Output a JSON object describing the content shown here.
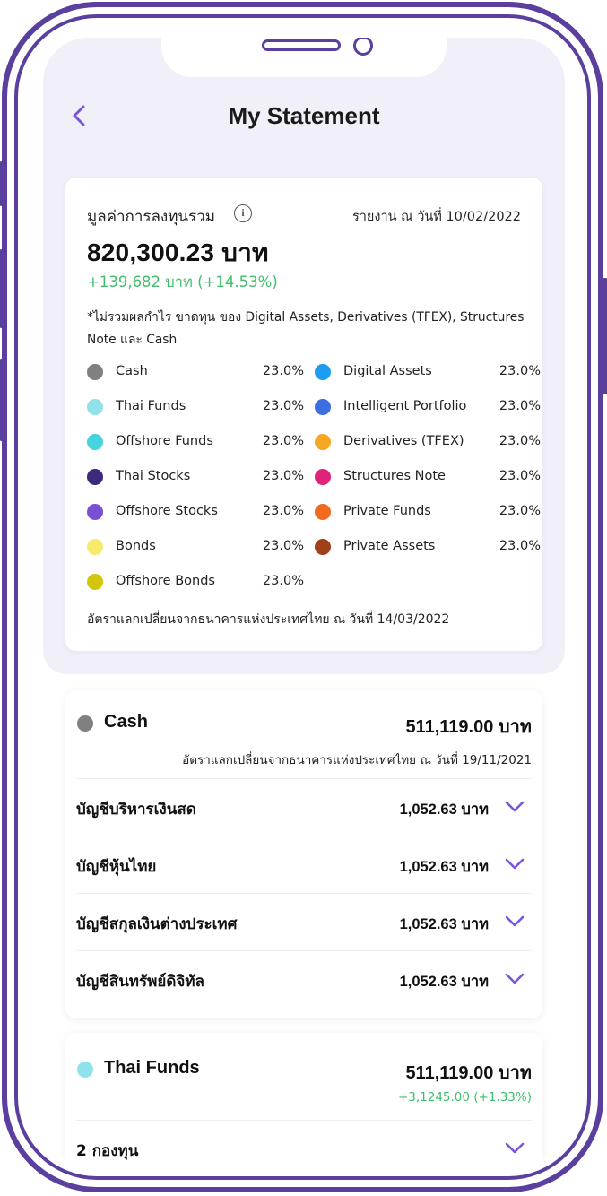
{
  "header": {
    "title": "My Statement"
  },
  "summary": {
    "label": "มูลค่าการลงทุนรวม",
    "report_date": "รายงาน ณ วันที่ 10/02/2022",
    "total": "820,300.23 บาท",
    "gain": "+139,682 บาท (+14.53%)",
    "note": "*ไม่รวมผลกำไร ขาดทุน ของ Digital Assets, Derivatives (TFEX), Structures Note และ Cash",
    "fx_note": "อัตราแลกเปลี่ยนจากธนาคารแห่งประเทศไทย ณ วันที่ 14/03/2022",
    "legend_left": [
      {
        "name": "Cash",
        "pct": "23.0%",
        "color": "#808080"
      },
      {
        "name": "Thai Funds",
        "pct": "23.0%",
        "color": "#8fe2ea"
      },
      {
        "name": "Offshore Funds",
        "pct": "23.0%",
        "color": "#45d3dd"
      },
      {
        "name": "Thai Stocks",
        "pct": "23.0%",
        "color": "#3d2a7c"
      },
      {
        "name": "Offshore Stocks",
        "pct": "23.0%",
        "color": "#7b4fd4"
      },
      {
        "name": "Bonds",
        "pct": "23.0%",
        "color": "#f7ea6a"
      },
      {
        "name": "Offshore Bonds",
        "pct": "23.0%",
        "color": "#d4c50d"
      }
    ],
    "legend_right": [
      {
        "name": "Digital Assets",
        "pct": "23.0%",
        "color": "#1e9cf0"
      },
      {
        "name": "Intelligent Portfolio",
        "pct": "23.0%",
        "color": "#3c6ee0"
      },
      {
        "name": "Derivatives (TFEX)",
        "pct": "23.0%",
        "color": "#f5a623"
      },
      {
        "name": "Structures Note",
        "pct": "23.0%",
        "color": "#e0237a"
      },
      {
        "name": "Private Funds",
        "pct": "23.0%",
        "color": "#f26b1d"
      },
      {
        "name": "Private Assets",
        "pct": "23.0%",
        "color": "#a0401a"
      }
    ]
  },
  "cash": {
    "name": "Cash",
    "value": "511,119.00 บาท",
    "fx_note": "อัตราแลกเปลี่ยนจากธนาคารแห่งประเทศไทย ณ วันที่ 19/11/2021",
    "color": "#808080",
    "accounts": [
      {
        "name": "บัญชีบริหารเงินสด",
        "value": "1,052.63 บาท"
      },
      {
        "name": "บัญชีหุ้นไทย",
        "value": "1,052.63 บาท"
      },
      {
        "name": "บัญชีสกุลเงินต่างประเทศ",
        "value": "1,052.63 บาท"
      },
      {
        "name": "บัญชีสินทรัพย์ดิจิทัล",
        "value": "1,052.63 บาท"
      }
    ]
  },
  "thai_funds": {
    "name": "Thai Funds",
    "value": "511,119.00 บาท",
    "gain": "+3,1245.00 (+1.33%)",
    "color": "#8fe2ea",
    "row_label": "2 กองทุน"
  },
  "colors": {
    "accent": "#7a55dc",
    "frame": "#5a3f9e",
    "positive": "#3fbf6b",
    "header_bg": "#f1f0f9"
  }
}
